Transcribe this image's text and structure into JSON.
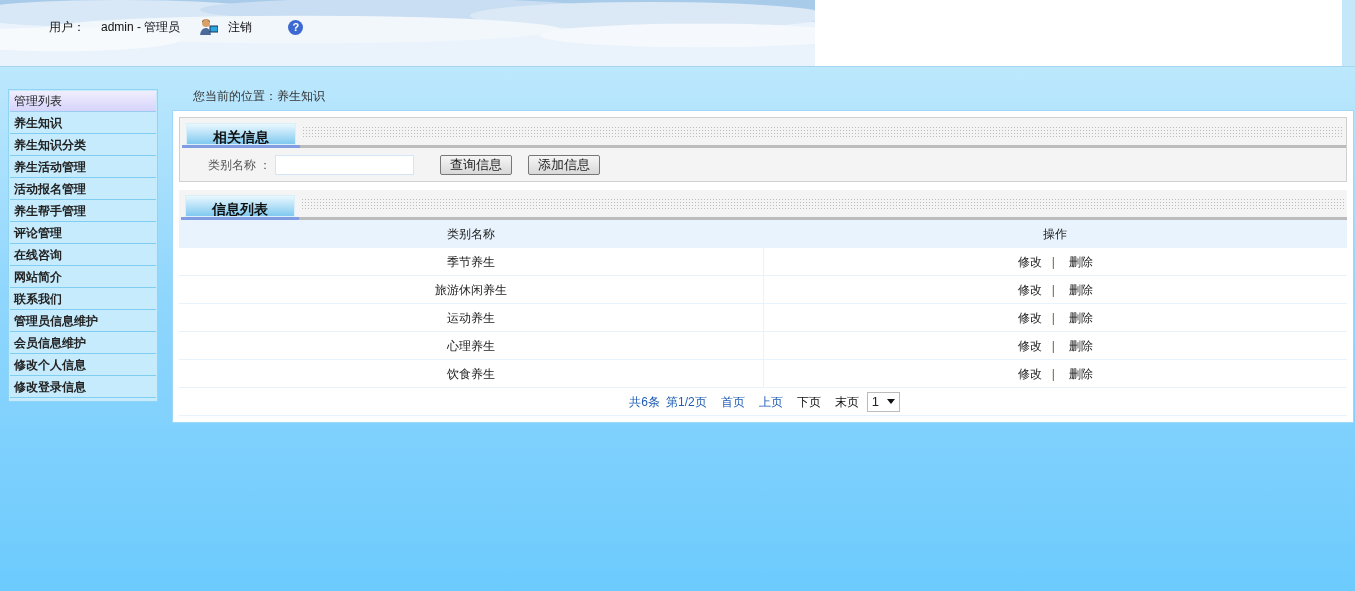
{
  "header": {
    "user_label": "用户：",
    "user_value": "admin - 管理员",
    "logout": "注销",
    "help": "?"
  },
  "sidebar": {
    "title": "管理列表",
    "items": [
      "养生知识",
      "养生知识分类",
      "养生活动管理",
      "活动报名管理",
      "养生帮手管理",
      "评论管理",
      "在线咨询",
      "网站简介",
      "联系我们",
      "管理员信息维护",
      "会员信息维护",
      "修改个人信息",
      "修改登录信息"
    ]
  },
  "breadcrumb": "您当前的位置：养生知识",
  "search_section": {
    "title": "相关信息",
    "field_label": "类别名称 ：",
    "buttons": [
      "查询信息",
      "添加信息"
    ]
  },
  "list_section": {
    "title": "信息列表",
    "columns": [
      "类别名称",
      "操作"
    ],
    "rows": [
      {
        "name": "季节养生",
        "edit": "修改",
        "sep": "|",
        "delete": "删除"
      },
      {
        "name": "旅游休闲养生",
        "edit": "修改",
        "sep": "|",
        "delete": "删除"
      },
      {
        "name": "运动养生",
        "edit": "修改",
        "sep": "|",
        "delete": "删除"
      },
      {
        "name": "心理养生",
        "edit": "修改",
        "sep": "|",
        "delete": "删除"
      },
      {
        "name": "饮食养生",
        "edit": "修改",
        "sep": "|",
        "delete": "删除"
      }
    ]
  },
  "pager": {
    "total": "共6条",
    "page": "第1/2页",
    "links": [
      {
        "label": "首页",
        "disabled": false
      },
      {
        "label": "上页",
        "disabled": false
      },
      {
        "label": "下页",
        "disabled": true
      },
      {
        "label": "末页",
        "disabled": true
      }
    ],
    "select": "1"
  }
}
